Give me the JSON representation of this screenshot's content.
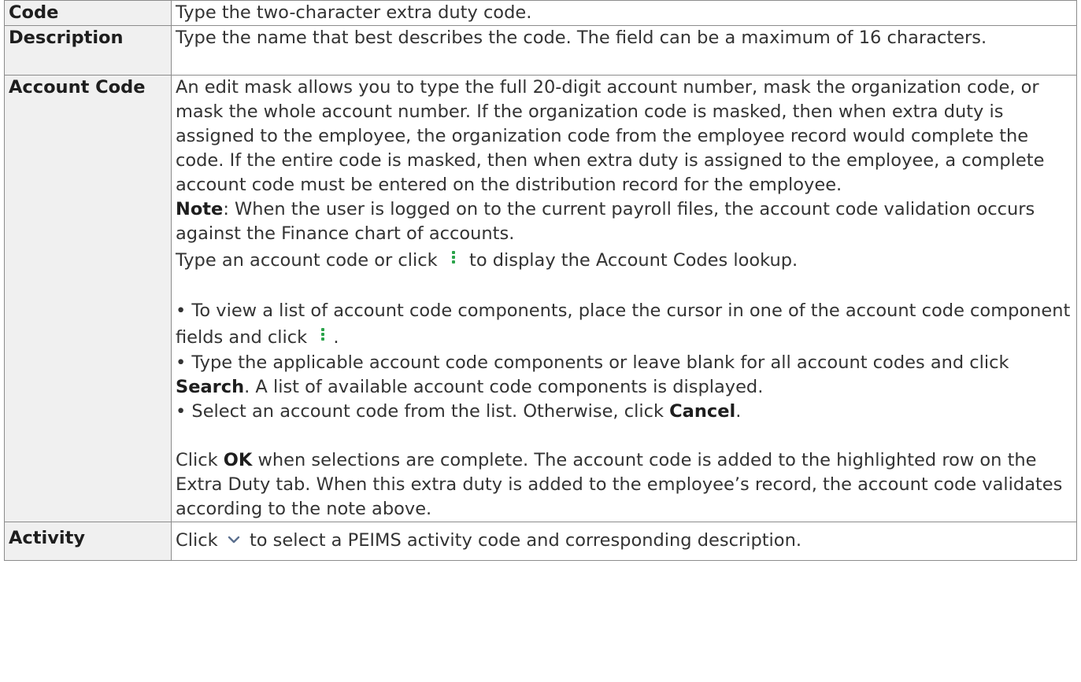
{
  "rows": [
    {
      "term": "Code",
      "text": "Type the two-character extra duty code."
    },
    {
      "term": "Description",
      "text": "Type the name that best describes the code. The field can be a maximum of 16 characters."
    },
    {
      "term": "Account Code",
      "intro": "An edit mask allows you to type the full 20-digit account number, mask the organization code, or mask the whole account number. If the organization code is masked, then when extra duty is assigned to the employee, the organization code from the employee record would complete the code. If the entire code is masked, then when extra duty is assigned to the employee, a complete account code must be entered on the distribution record for the employee.",
      "note_label": "Note",
      "note_text": ": When the user is logged on to the current payroll files, the account code validation occurs against the Finance chart of accounts.",
      "lookup_before": "Type an account code or click",
      "lookup_after": "to display the Account Codes lookup.",
      "bullet1": "• To view a list of account code components, place the cursor in one of the account code component fields and click",
      "bullet1_end": ".",
      "bullet2_start": "• Type the applicable account code components or leave blank for all account codes and click",
      "bullet2_bold": "Search",
      "bullet2_end": ". A list of available account code components is displayed.",
      "bullet3_start": "• Select an account code from the list. Otherwise, click",
      "bullet3_bold": "Cancel",
      "bullet3_end": ".",
      "final_start": "Click",
      "final_bold": "OK",
      "final_end": "when selections are complete. The account code is added to the highlighted row on the Extra Duty tab. When this extra duty is added to the employee’s record, the account code validates according to the note above."
    },
    {
      "term": "Activity",
      "text_before": "Click",
      "text_after": "to select a PEIMS activity code and corresponding description."
    }
  ],
  "icons": {
    "lookup": "vertical-dots-lookup-icon",
    "dropdown": "chevron-down-icon",
    "lookup_color": "#2aa34a",
    "dropdown_color": "#5b6f8e"
  },
  "colors": {
    "term_background": "#f0f0f0",
    "border": "#8c8c8c",
    "text": "#333333"
  }
}
